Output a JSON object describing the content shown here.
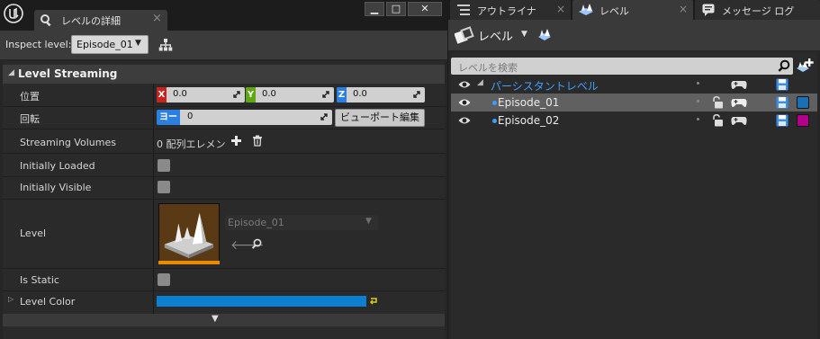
{
  "details_window": {
    "tab_title": "レベルの詳細",
    "tab_close": "×",
    "win_controls": [
      "▁",
      "□",
      "✕"
    ],
    "inspect_label": "Inspect level:",
    "inspect_value": "Episode_01",
    "section_title": "Level Streaming",
    "properties": {
      "position": {
        "label": "位置",
        "x_tag": "X",
        "x": "0.0",
        "y_tag": "Y",
        "y": "0.0",
        "z_tag": "Z",
        "z": "0.0"
      },
      "rotation": {
        "label": "回転",
        "axis_tag": "ヨー",
        "value": "0",
        "viewport_button": "ビューポート編集"
      },
      "streaming_volumes": {
        "label": "Streaming Volumes",
        "value": "0 配列エレメン"
      },
      "initially_loaded": {
        "label": "Initially Loaded"
      },
      "initially_visible": {
        "label": "Initially Visible"
      },
      "level": {
        "label": "Level",
        "value": "Episode_01"
      },
      "is_static": {
        "label": "Is Static"
      },
      "level_color": {
        "label": "Level Color",
        "color": "#0d7fd0"
      }
    },
    "colors": {
      "x_axis": "#c8231c",
      "y_axis": "#5fa814",
      "z_axis": "#2a7fe0"
    }
  },
  "levels_window": {
    "tabs": [
      {
        "label": "アウトライナ",
        "icon": "outliner-icon"
      },
      {
        "label": "レベル",
        "icon": "levels-icon",
        "active": true
      },
      {
        "label": "メッセージ ログ",
        "icon": "message-log-icon"
      }
    ],
    "tab_close": "×",
    "menu_label": "レベル",
    "search_placeholder": "レベルを検索",
    "levels": [
      {
        "name": "パーシスタントレベル",
        "persistent": true,
        "color": ""
      },
      {
        "name": "Episode_01",
        "selected": true,
        "color": "#1b6fb5"
      },
      {
        "name": "Episode_02",
        "color": "#b3008a"
      }
    ]
  }
}
